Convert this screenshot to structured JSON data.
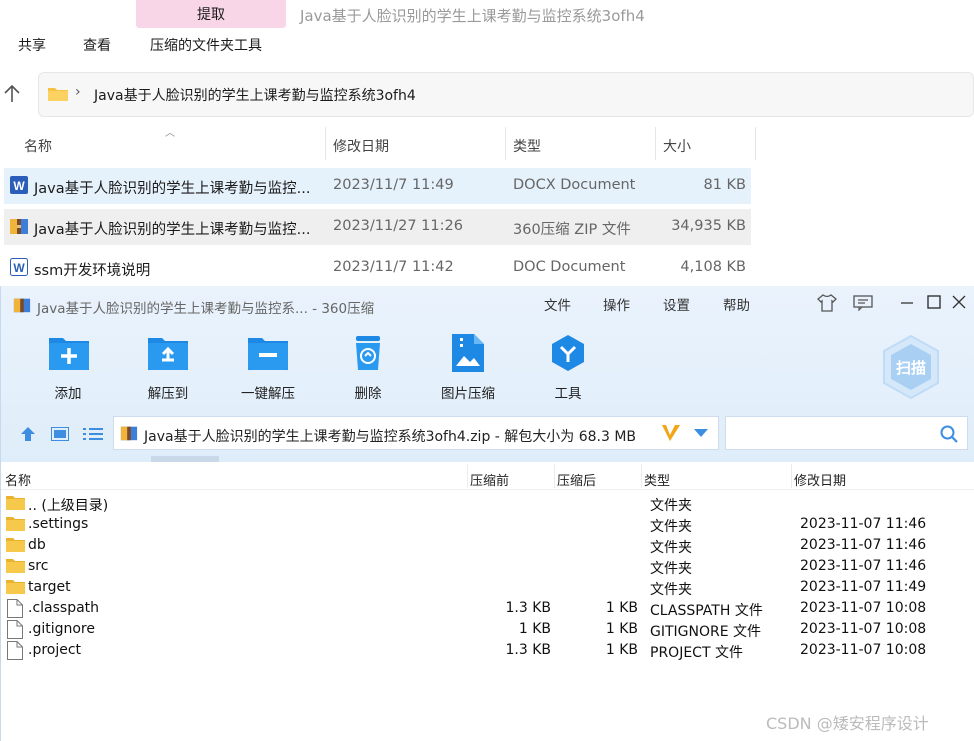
{
  "explorer": {
    "ribbon_tab": "提取",
    "window_title": "Java基于人脸识别的学生上课考勤与监控系统3ofh4",
    "ribbon": [
      "共享",
      "查看",
      "压缩的文件夹工具"
    ],
    "address": "Java基于人脸识别的学生上课考勤与监控系统3ofh4",
    "columns": [
      "名称",
      "修改日期",
      "类型",
      "大小"
    ],
    "files": [
      {
        "icon": "word-icon",
        "name": "Java基于人脸识别的学生上课考勤与监控...",
        "date": "2023/11/7 11:49",
        "type": "DOCX Document",
        "size": "81 KB",
        "selected": true
      },
      {
        "icon": "archive-icon",
        "name": "Java基于人脸识别的学生上课考勤与监控...",
        "date": "2023/11/27 11:26",
        "type": "360压缩 ZIP 文件",
        "size": "34,935 KB",
        "selected": false,
        "hover": true
      },
      {
        "icon": "word-icon",
        "name": "ssm开发环境说明",
        "date": "2023/11/7 11:42",
        "type": "DOC Document",
        "size": "4,108 KB",
        "selected": false
      }
    ]
  },
  "zip360": {
    "title": "Java基于人脸识别的学生上课考勤与监控系... - 360压缩",
    "menu": [
      "文件",
      "操作",
      "设置",
      "帮助"
    ],
    "tools": [
      {
        "icon": "add-icon",
        "label": "添加"
      },
      {
        "icon": "extract-to-icon",
        "label": "解压到"
      },
      {
        "icon": "one-click-extract-icon",
        "label": "一键解压"
      },
      {
        "icon": "delete-icon",
        "label": "删除"
      },
      {
        "icon": "image-compress-icon",
        "label": "图片压缩"
      },
      {
        "icon": "tools-icon",
        "label": "工具"
      }
    ],
    "scan_label": "扫描",
    "path": "Java基于人脸识别的学生上课考勤与监控系统3ofh4.zip - 解包大小为 68.3 MB",
    "columns": [
      "名称",
      "压缩前",
      "压缩后",
      "类型",
      "修改日期"
    ],
    "files": [
      {
        "icon": "folder-icon",
        "name": ".. (上级目录)",
        "before": "",
        "after": "",
        "type": "文件夹",
        "date": ""
      },
      {
        "icon": "folder-icon",
        "name": ".settings",
        "before": "",
        "after": "",
        "type": "文件夹",
        "date": "2023-11-07 11:46"
      },
      {
        "icon": "folder-icon",
        "name": "db",
        "before": "",
        "after": "",
        "type": "文件夹",
        "date": "2023-11-07 11:46"
      },
      {
        "icon": "folder-icon",
        "name": "src",
        "before": "",
        "after": "",
        "type": "文件夹",
        "date": "2023-11-07 11:46"
      },
      {
        "icon": "folder-icon",
        "name": "target",
        "before": "",
        "after": "",
        "type": "文件夹",
        "date": "2023-11-07 11:49"
      },
      {
        "icon": "file-icon",
        "name": ".classpath",
        "before": "1.3 KB",
        "after": "1 KB",
        "type": "CLASSPATH 文件",
        "date": "2023-11-07 10:08"
      },
      {
        "icon": "file-icon",
        "name": ".gitignore",
        "before": "1 KB",
        "after": "1 KB",
        "type": "GITIGNORE 文件",
        "date": "2023-11-07 10:08"
      },
      {
        "icon": "file-icon",
        "name": ".project",
        "before": "1.3 KB",
        "after": "1 KB",
        "type": "PROJECT 文件",
        "date": "2023-11-07 10:08"
      }
    ]
  },
  "watermark": "CSDN @矮安程序设计",
  "colors": {
    "accent": "#1e88e5",
    "selected_row": "#e5f1fb",
    "hover_row": "#efefef",
    "extract_tab": "#f9d6e7"
  }
}
